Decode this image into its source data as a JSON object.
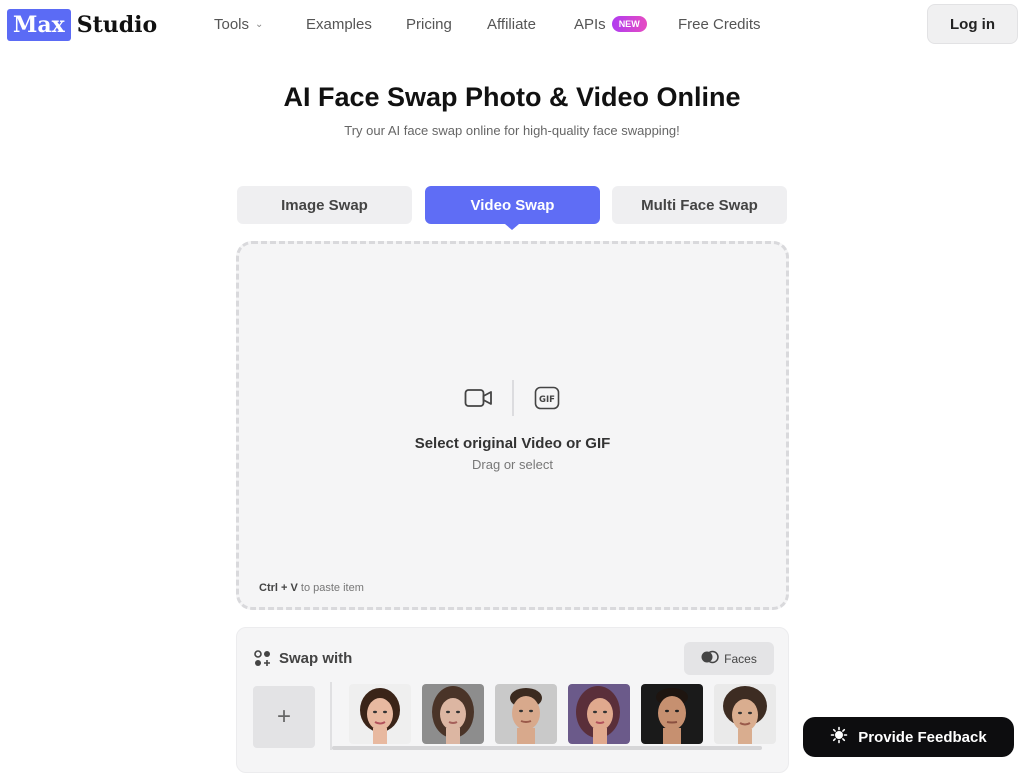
{
  "brand": {
    "logo_box": "Max",
    "logo_word": "Studio",
    "accent": "#5f6df5"
  },
  "nav": {
    "items": [
      {
        "label": "Tools",
        "has_dropdown": true,
        "icon": "chevron-down-icon"
      },
      {
        "label": "Examples"
      },
      {
        "label": "Pricing"
      },
      {
        "label": "Affiliate"
      },
      {
        "label": "APIs",
        "badge": "NEW"
      },
      {
        "label": "Free Credits"
      }
    ],
    "login_label": "Log in"
  },
  "hero": {
    "title": "AI Face Swap Photo & Video Online",
    "subtitle": "Try our AI face swap online for high-quality face swapping!"
  },
  "tabs": [
    {
      "label": "Image Swap",
      "active": false
    },
    {
      "label": "Video Swap",
      "active": true
    },
    {
      "label": "Multi Face Swap",
      "active": false
    }
  ],
  "dropzone": {
    "icons": [
      "video-camera-icon",
      "gif-icon"
    ],
    "main_text": "Select original Video or GIF",
    "sub_text": "Drag or select",
    "paste_key": "Ctrl + V",
    "paste_text": "to paste item"
  },
  "swap": {
    "heading": "Swap with",
    "heading_icon": "faces-grid-icon",
    "faces_button": "Faces",
    "faces_button_icon": "faces-toggle-icon",
    "add_label": "+",
    "faces": [
      {
        "name": "face-1",
        "skin": "#e8b9a0",
        "hair": "#3a2418",
        "bg": "#efefef"
      },
      {
        "name": "face-2",
        "skin": "#dcb6a2",
        "hair": "#4a3428",
        "bg": "#8d8d8d"
      },
      {
        "name": "face-3",
        "skin": "#d8a98c",
        "hair": "#3b2a1f",
        "bg": "#c9c9c9"
      },
      {
        "name": "face-4",
        "skin": "#e0a98e",
        "hair": "#5a2f3a",
        "bg": "#6b5a8a"
      },
      {
        "name": "face-5",
        "skin": "#c69070",
        "hair": "#1e1510",
        "bg": "#1a1a1a"
      },
      {
        "name": "face-6",
        "skin": "#d9ad8f",
        "hair": "#3d2c22",
        "bg": "#eaeaea"
      }
    ]
  },
  "feedback": {
    "label": "Provide Feedback",
    "icon": "lightbulb-icon"
  }
}
